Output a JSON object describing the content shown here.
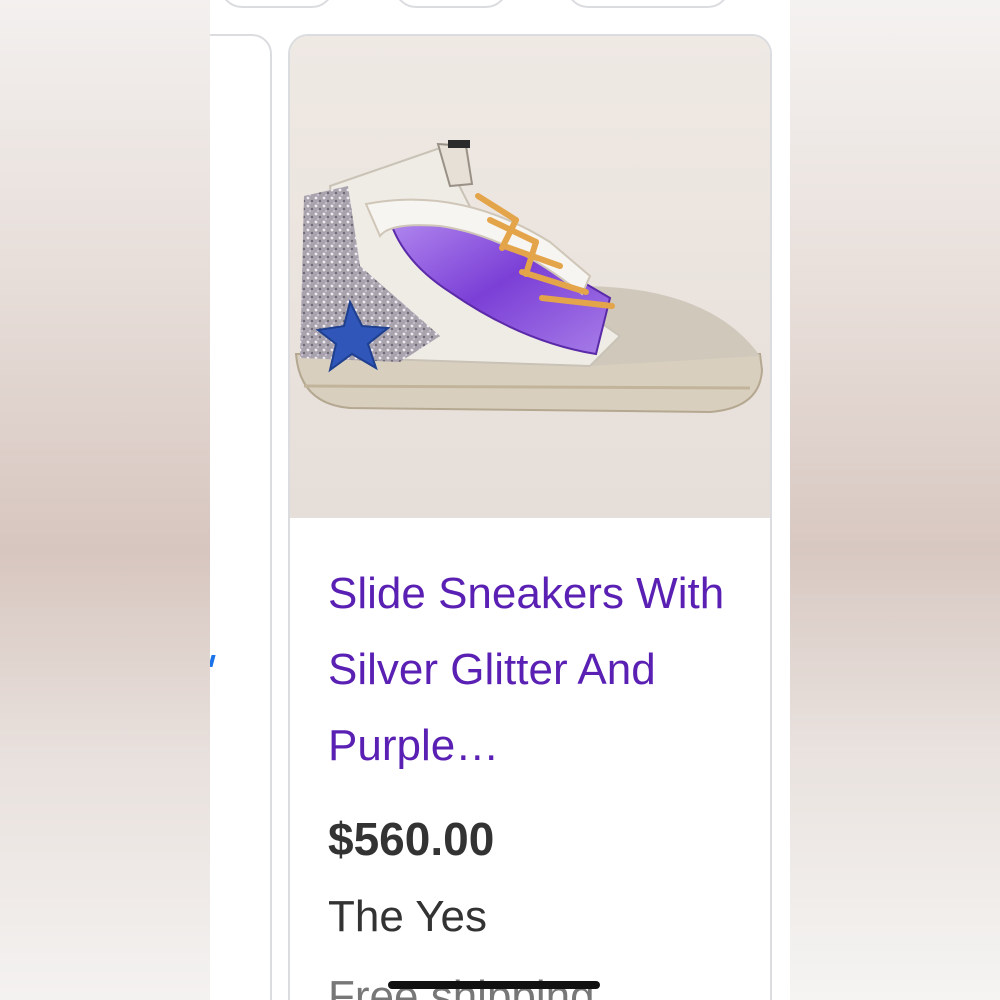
{
  "product": {
    "image_alt": "Slide sneaker with silver glitter, purple metallic panel and blue star",
    "title": "Slide Sneakers With Silver Glitter And Purple…",
    "price": "$560.00",
    "seller": "The Yes",
    "shipping": "Free shipping"
  },
  "colors": {
    "title_link": "#5a1fb3",
    "price_text": "#333333",
    "card_border": "#dadce0"
  }
}
